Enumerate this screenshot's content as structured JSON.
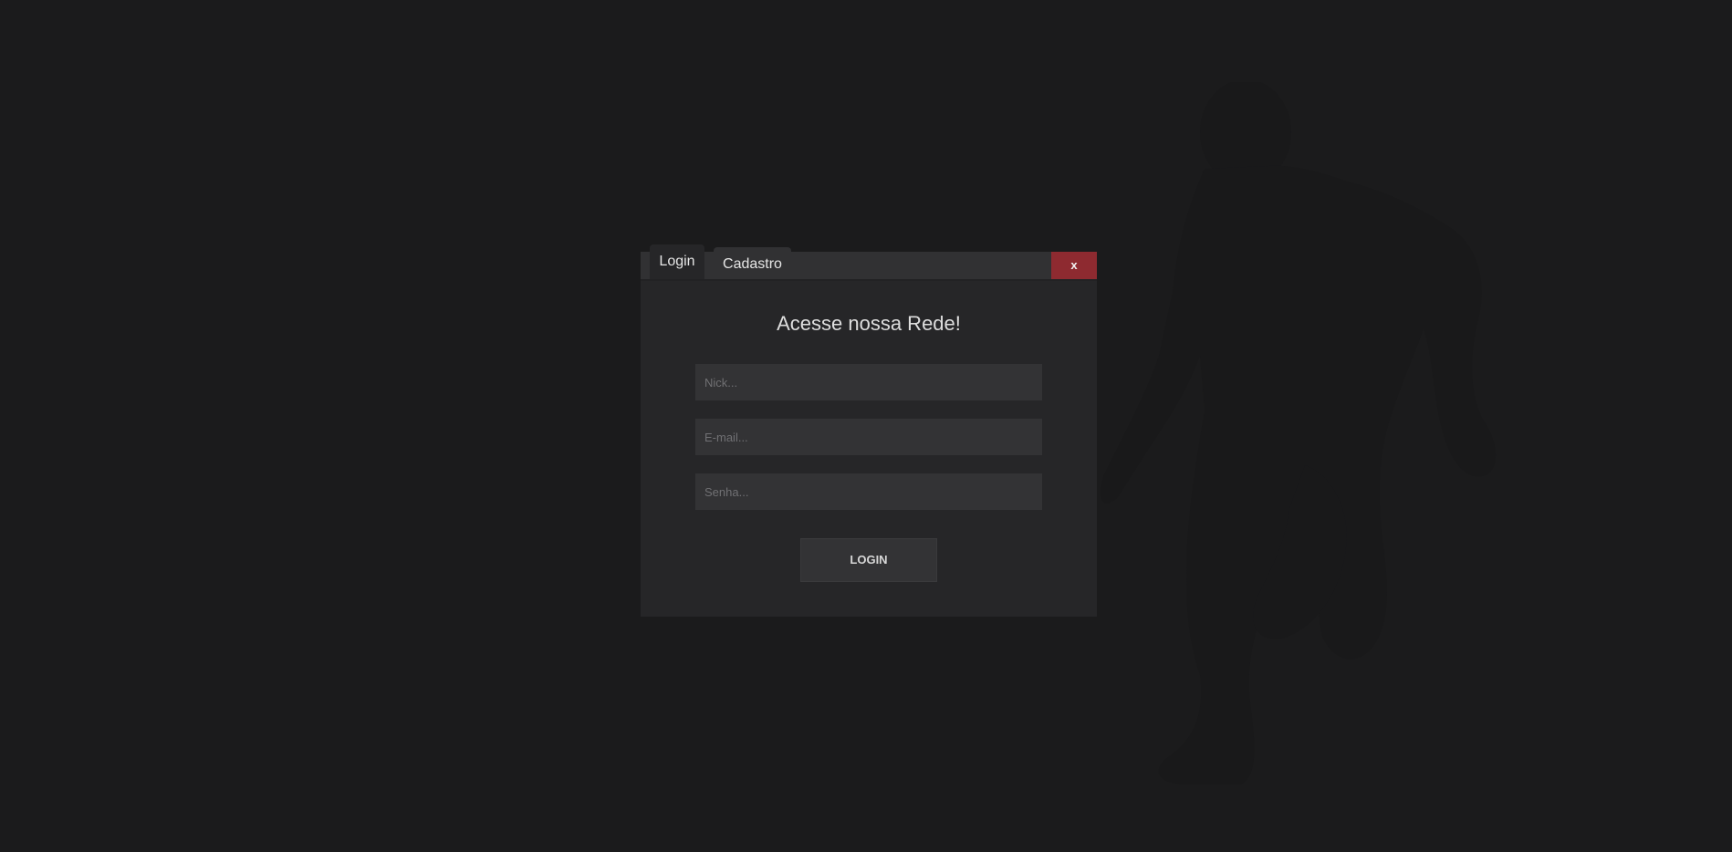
{
  "tabs": [
    {
      "label": "Login",
      "active": true
    },
    {
      "label": "Cadastro",
      "active": false
    }
  ],
  "close_label": "x",
  "title": "Acesse nossa Rede!",
  "fields": {
    "nick_placeholder": "Nick...",
    "email_placeholder": "E-mail...",
    "senha_placeholder": "Senha..."
  },
  "login_button_label": "LOGIN",
  "colors": {
    "background": "#1b1b1c",
    "panel": "#262628",
    "tabbar": "#313133",
    "close_button": "#8e2a30",
    "input": "#333335"
  },
  "decorations": {
    "background_figure": "player-silhouette"
  }
}
